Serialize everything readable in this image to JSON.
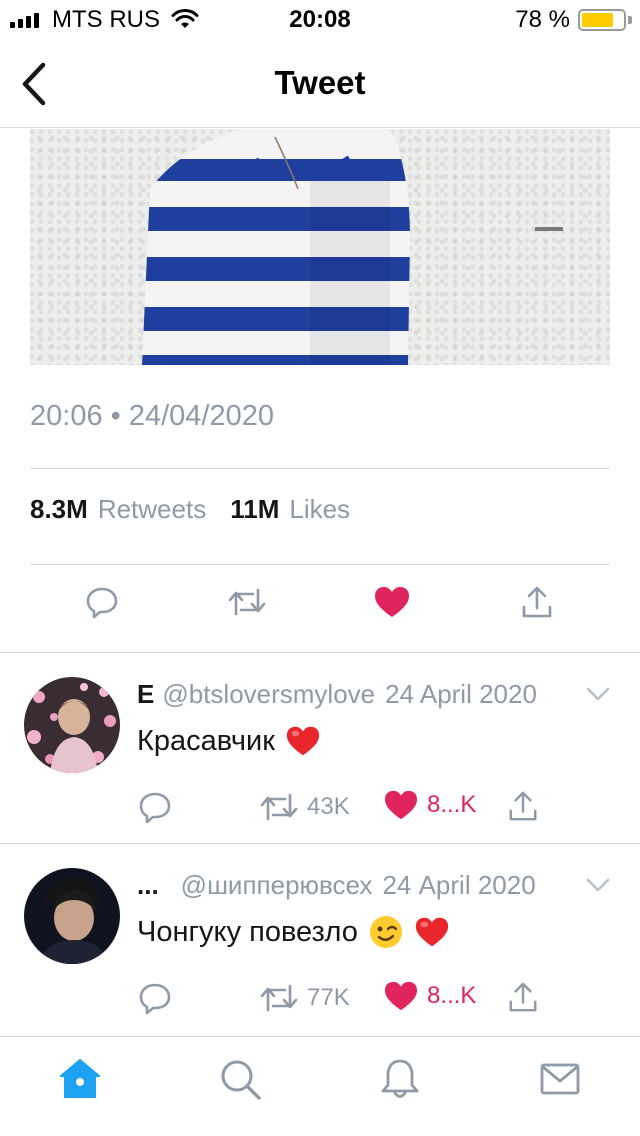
{
  "status_bar": {
    "carrier": "MTS RUS",
    "time": "20:08",
    "battery_percent": "78 %",
    "battery_level": 0.78,
    "battery_color": "#ffcc00"
  },
  "nav": {
    "title": "Tweet",
    "back_icon": "chevron-left-icon"
  },
  "tweet": {
    "timestamp": "20:06 • 24/04/2020",
    "retweets_count": "8.3M",
    "retweets_label": "Retweets",
    "likes_count": "11M",
    "likes_label": "Likes",
    "liked": true,
    "actions": [
      "reply-icon",
      "retweet-icon",
      "like-icon",
      "share-icon"
    ]
  },
  "replies": [
    {
      "name": "E",
      "handle": "@btsloversmylove",
      "date": "24 April 2020",
      "text": "Красавчик",
      "emojis": [
        "red-heart-emoji"
      ],
      "retweets": "43K",
      "likes": "8...K"
    },
    {
      "name": "...",
      "handle": "@шипперювсех",
      "date": "24 April 2020",
      "text": "Чонгуку повезло",
      "emojis": [
        "winking-face-emoji",
        "red-heart-emoji"
      ],
      "retweets": "77K",
      "likes": "8...K"
    }
  ],
  "tab_bar": {
    "tabs": [
      "home-icon",
      "search-icon",
      "notifications-icon",
      "messages-icon"
    ],
    "active": "home-icon"
  },
  "colors": {
    "accent": "#1da1f2",
    "like": "#e0245e",
    "muted": "#8e9aa6",
    "divider": "#d8dde1"
  }
}
